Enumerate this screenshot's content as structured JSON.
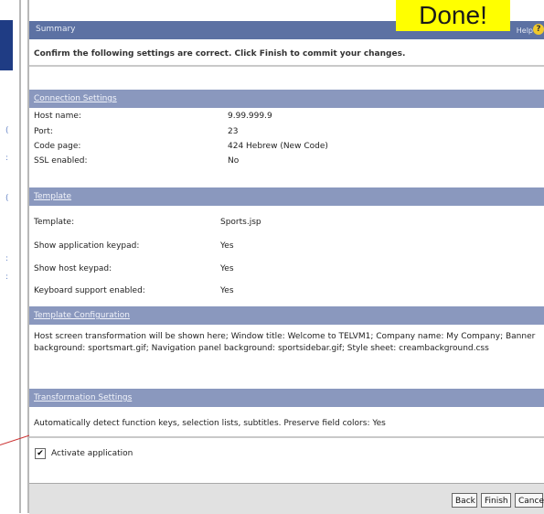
{
  "overlay": {
    "done": "Done!"
  },
  "summary": {
    "title": "Summary",
    "help": "Help",
    "help_icon": "?"
  },
  "confirm": {
    "text": "Confirm the following settings are correct. Click Finish to commit your changes."
  },
  "connection": {
    "header": "Connection Settings",
    "rows": [
      {
        "label": "Host name:",
        "value": "9.99.999.9"
      },
      {
        "label": "Port:",
        "value": "23"
      },
      {
        "label": "Code page:",
        "value": "424 Hebrew (New Code)"
      },
      {
        "label": "SSL enabled:",
        "value": "No"
      }
    ]
  },
  "template": {
    "header": "Template",
    "rows": [
      {
        "label": "Template:",
        "value": "Sports.jsp"
      },
      {
        "label": "Show application keypad:",
        "value": "Yes"
      },
      {
        "label": "Show host keypad:",
        "value": "Yes"
      },
      {
        "label": "Keyboard support enabled:",
        "value": "Yes"
      }
    ]
  },
  "template_config": {
    "header": "Template Configuration",
    "text": "Host screen transformation will be shown here; Window title: Welcome to TELVM1; Company name: My Company; Banner background: sportsmart.gif; Navigation panel background: sportsidebar.gif; Style sheet: creambackground.css"
  },
  "transformation": {
    "header": "Transformation Settings",
    "text": "Automatically detect function keys, selection lists, subtitles. Preserve field colors: Yes"
  },
  "activate": {
    "label": "Activate application",
    "checked": "✔"
  },
  "buttons": {
    "back": "Back",
    "finish": "Finish",
    "cancel": "Cancel"
  }
}
